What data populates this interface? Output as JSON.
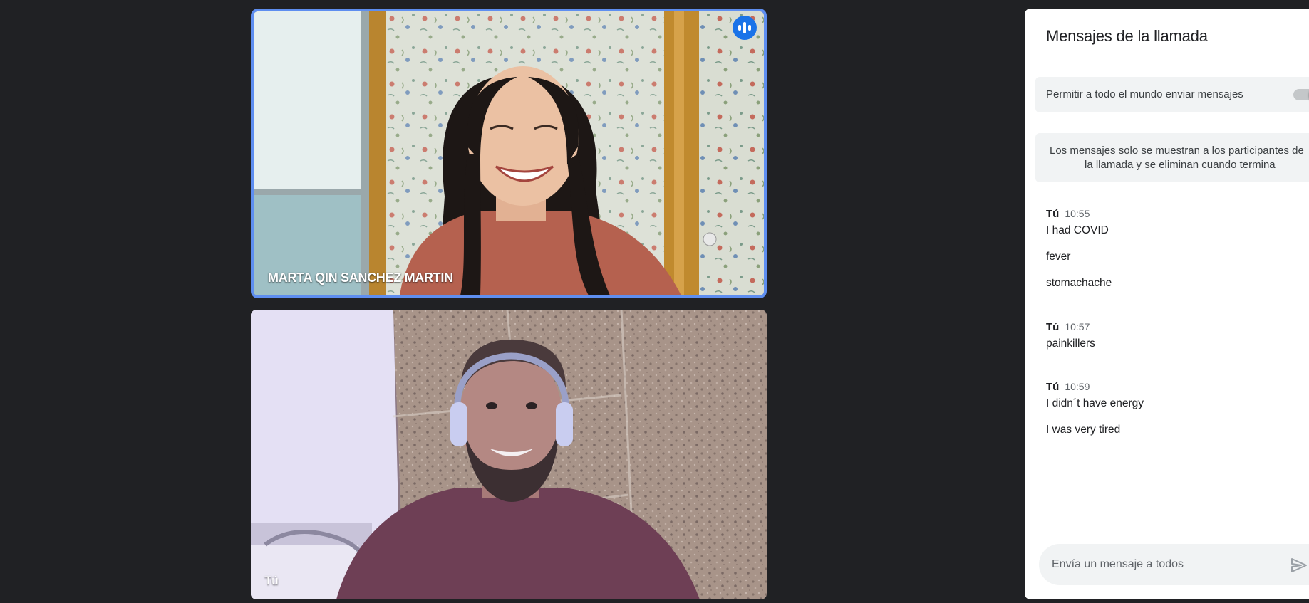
{
  "video_tiles": {
    "participant": {
      "name": "MARTA QIN SANCHEZ MARTIN",
      "speaking": true
    },
    "self": {
      "name": "Tú"
    }
  },
  "chat": {
    "title": "Mensajes de la llamada",
    "allow_messages": {
      "label": "Permitir a todo el mundo enviar mensajes",
      "enabled": true
    },
    "info_line1": "Los mensajes solo se muestran a los participantes de",
    "info_line2": "la llamada y se eliminan cuando termina",
    "groups": [
      {
        "sender": "Tú",
        "time": "10:55",
        "messages": [
          "I had COVID",
          "fever",
          "stomachache"
        ]
      },
      {
        "sender": "Tú",
        "time": "10:57",
        "messages": [
          "painkillers"
        ]
      },
      {
        "sender": "Tú",
        "time": "10:59",
        "messages": [
          "I didn´t have energy",
          "I was very tired"
        ]
      }
    ],
    "composer_placeholder": "Envía un mensaje a todos",
    "icons": {
      "send": "send-icon",
      "speaking": "audio-level-icon"
    },
    "colors": {
      "accent": "#1a73e8",
      "speaking_border": "#5e8ef0",
      "background": "#202124"
    }
  }
}
